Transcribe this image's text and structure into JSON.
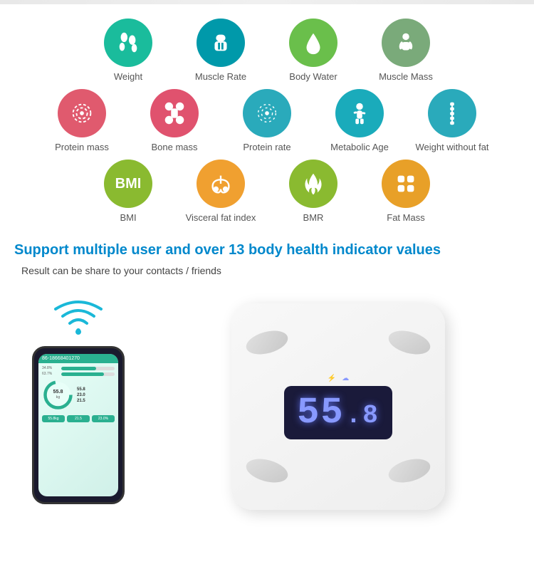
{
  "top_border": true,
  "row1": {
    "items": [
      {
        "label": "Weight",
        "color": "teal",
        "icon": "footprints"
      },
      {
        "label": "Muscle Rate",
        "color": "blue-teal",
        "icon": "muscle-body"
      },
      {
        "label": "Body Water",
        "color": "green",
        "icon": "water-drop"
      },
      {
        "label": "Muscle Mass",
        "color": "gray-green",
        "icon": "arm-flex"
      }
    ]
  },
  "row2": {
    "items": [
      {
        "label": "Protein mass",
        "color": "pink",
        "icon": "protein"
      },
      {
        "label": "Bone mass",
        "color": "coral",
        "icon": "bone"
      },
      {
        "label": "Protein rate",
        "color": "teal2",
        "icon": "protein-dots"
      },
      {
        "label": "Metabolic Age",
        "color": "teal3",
        "icon": "person-stand"
      },
      {
        "label": "Weight without fat",
        "color": "teal2",
        "icon": "spine"
      }
    ]
  },
  "row3": {
    "items": [
      {
        "label": "BMI",
        "color": "lime",
        "icon": "bmi-text"
      },
      {
        "label": "Visceral fat index",
        "color": "orange",
        "icon": "lungs"
      },
      {
        "label": "BMR",
        "color": "lime",
        "icon": "flame"
      },
      {
        "label": "Fat Mass",
        "color": "orange2",
        "icon": "fat-grid"
      }
    ]
  },
  "support": {
    "title": "Support multiple user and over 13 body health indicator values",
    "subtitle": "Result can be share to your contacts / friends"
  },
  "phone": {
    "header_text": "86-18668401270",
    "bars": [
      {
        "label": "34.8%",
        "pct": 65
      },
      {
        "label": "63.7%",
        "pct": 80
      }
    ],
    "circle_value": "55.8",
    "stats": [
      {
        "key": "55.8",
        "unit": ""
      },
      {
        "key": "23.0",
        "unit": ""
      },
      {
        "key": "21.5",
        "unit": ""
      }
    ],
    "bottom_tabs": [
      "55.8kg",
      "21.5",
      "23.0%"
    ]
  },
  "scale": {
    "display_value": "55",
    "display_decimal": ".8",
    "bt_icon": "bluetooth"
  }
}
